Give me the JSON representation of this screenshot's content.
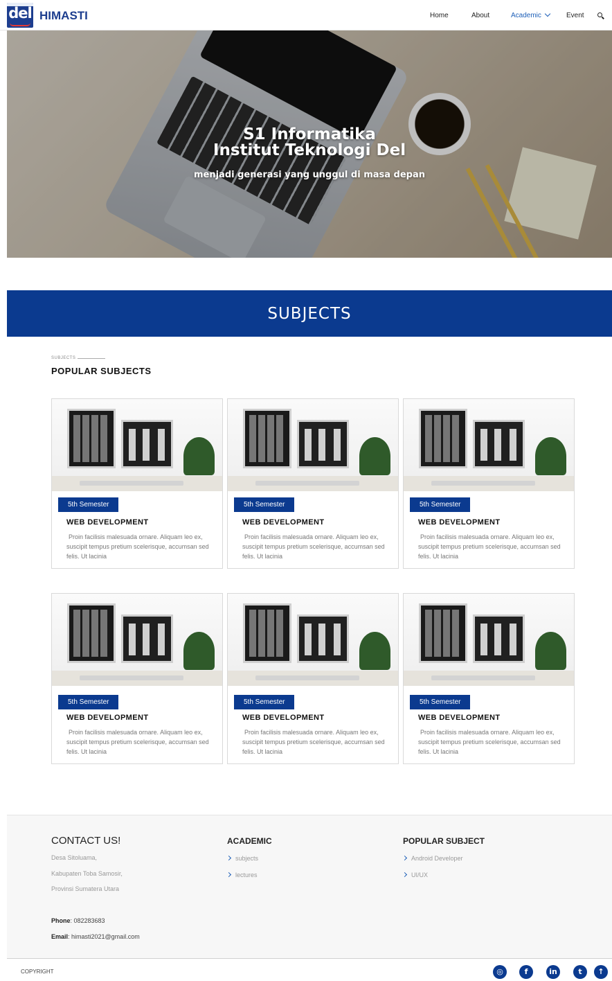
{
  "header": {
    "logo_text": "del",
    "brand": "HIMASTI",
    "nav": [
      {
        "label": "Home"
      },
      {
        "label": "About"
      },
      {
        "label": "Academic"
      },
      {
        "label": "Event"
      }
    ]
  },
  "hero": {
    "title_line1": "S1 Informatika",
    "title_line2": "Institut Teknologi Del",
    "tagline": "menjadi generasi yang unggul di masa depan"
  },
  "banner": {
    "title": "SUBJECTS"
  },
  "section": {
    "kicker": "SUBJECTS",
    "title": "POPULAR SUBJECTS"
  },
  "cards": [
    {
      "badge": "5th Semester",
      "title": "WEB DEVELOPMENT",
      "desc": "Proin facilisis malesuada ornare. Aliquam leo ex, suscipit tempus pretium scelerisque, accumsan sed felis. Ut lacinia"
    },
    {
      "badge": "5th Semester",
      "title": "WEB DEVELOPMENT",
      "desc": "Proin facilisis malesuada ornare. Aliquam leo ex, suscipit tempus pretium scelerisque, accumsan sed felis. Ut lacinia"
    },
    {
      "badge": "5th Semester",
      "title": "WEB DEVELOPMENT",
      "desc": "Proin facilisis malesuada ornare. Aliquam leo ex, suscipit tempus pretium scelerisque, accumsan sed felis. Ut lacinia"
    },
    {
      "badge": "5th Semester",
      "title": "WEB DEVELOPMENT",
      "desc": "Proin facilisis malesuada ornare. Aliquam leo ex, suscipit tempus pretium scelerisque, accumsan sed felis. Ut lacinia"
    },
    {
      "badge": "5th Semester",
      "title": "WEB DEVELOPMENT",
      "desc": "Proin facilisis malesuada ornare. Aliquam leo ex, suscipit tempus pretium scelerisque, accumsan sed felis. Ut lacinia"
    },
    {
      "badge": "5th Semester",
      "title": "WEB DEVELOPMENT",
      "desc": "Proin facilisis malesuada ornare. Aliquam leo ex, suscipit tempus pretium scelerisque, accumsan sed felis. Ut lacinia"
    }
  ],
  "footer": {
    "contact_title": "CONTACT US!",
    "address": [
      "Desa Sitoluama,",
      "Kabupaten Toba Samosir,",
      "Provinsi Sumatera Utara"
    ],
    "phone_label": "Phone",
    "phone": ": 082283683",
    "email_label": "Email",
    "email": ": himasti2021@gmail.com",
    "academic_title": "ACADEMIC",
    "academic_links": [
      "subjects",
      "lectures"
    ],
    "popular_title": "POPULAR SUBJECT",
    "popular_links": [
      "Android Developer",
      "UI/UX"
    ],
    "copyright": "COPYRIGHT"
  },
  "social": [
    {
      "name": "instagram-icon",
      "glyph": "◎"
    },
    {
      "name": "facebook-icon",
      "glyph": "f"
    },
    {
      "name": "linkedin-icon",
      "glyph": "in"
    },
    {
      "name": "twitter-icon",
      "glyph": "t"
    },
    {
      "name": "back-to-top-icon",
      "glyph": "↑"
    }
  ]
}
